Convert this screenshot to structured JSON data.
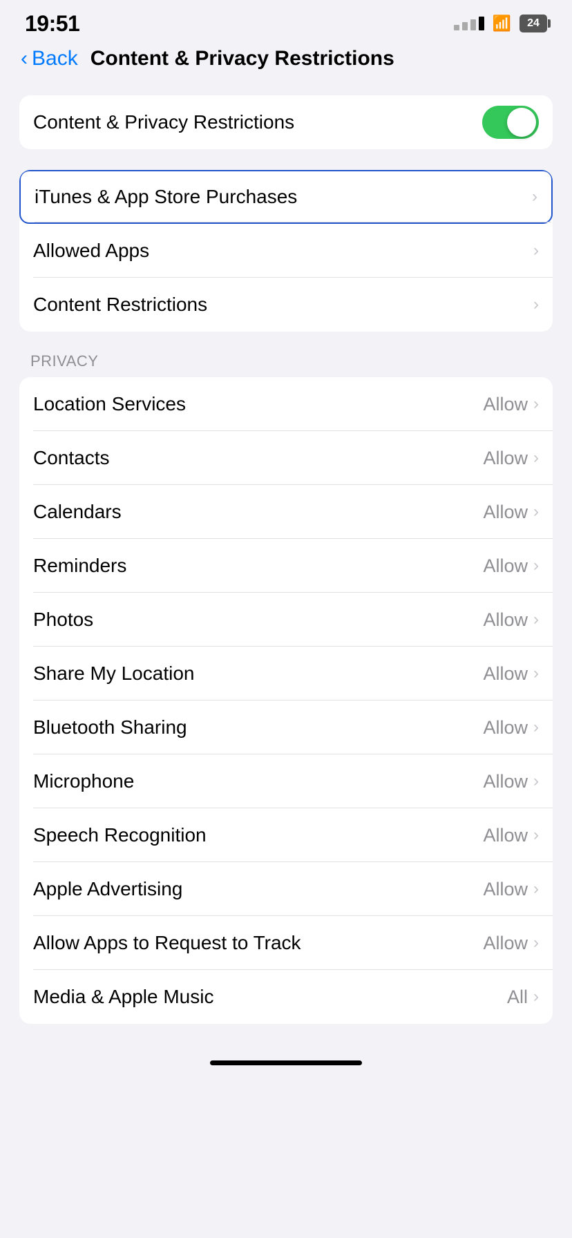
{
  "statusBar": {
    "time": "19:51",
    "battery": "24"
  },
  "navBar": {
    "backLabel": "Back",
    "title": "Content & Privacy Restrictions"
  },
  "toggle": {
    "label": "Content & Privacy Restrictions",
    "enabled": true
  },
  "mainItems": [
    {
      "label": "iTunes & App Store Purchases",
      "highlighted": true
    },
    {
      "label": "Allowed Apps",
      "highlighted": false
    },
    {
      "label": "Content Restrictions",
      "highlighted": false
    }
  ],
  "privacySectionLabel": "PRIVACY",
  "privacyItems": [
    {
      "label": "Location Services",
      "value": "Allow"
    },
    {
      "label": "Contacts",
      "value": "Allow"
    },
    {
      "label": "Calendars",
      "value": "Allow"
    },
    {
      "label": "Reminders",
      "value": "Allow"
    },
    {
      "label": "Photos",
      "value": "Allow"
    },
    {
      "label": "Share My Location",
      "value": "Allow"
    },
    {
      "label": "Bluetooth Sharing",
      "value": "Allow"
    },
    {
      "label": "Microphone",
      "value": "Allow"
    },
    {
      "label": "Speech Recognition",
      "value": "Allow"
    },
    {
      "label": "Apple Advertising",
      "value": "Allow"
    },
    {
      "label": "Allow Apps to Request to Track",
      "value": "Allow"
    },
    {
      "label": "Media & Apple Music",
      "value": "All"
    }
  ]
}
